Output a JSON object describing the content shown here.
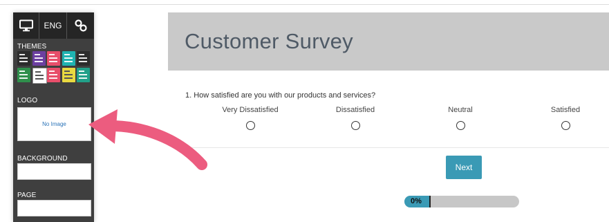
{
  "toolbar": {
    "monitor_icon": "monitor-icon",
    "language_label": "ENG",
    "link_icon": "link-icon"
  },
  "sidebar": {
    "themes_label": "THEMES",
    "logo_label": "LOGO",
    "logo_placeholder": "No Image",
    "background_label": "BACKGROUND",
    "page_label": "PAGE",
    "theme_colors": [
      "#2c2c2c",
      "#6b3fa0",
      "#e84e6a",
      "#1fb3b1",
      "#2c2c2c",
      "#2f8f4b",
      "#ffffff",
      "#e84e6a",
      "#e8d940",
      "#21a089"
    ]
  },
  "survey": {
    "title": "Customer Survey",
    "question": "1. How satisfied are you with our products and services?",
    "options": [
      "Very Dissatisfied",
      "Dissatisfied",
      "Neutral",
      "Satisfied"
    ],
    "next_label": "Next",
    "progress_text": "0%",
    "progress_value": 0
  },
  "colors": {
    "accent": "#3a9ab5",
    "arrow": "#ec5c7f",
    "header_bg": "#c9c9c9",
    "sidebar_bg": "#3f3f3f"
  }
}
